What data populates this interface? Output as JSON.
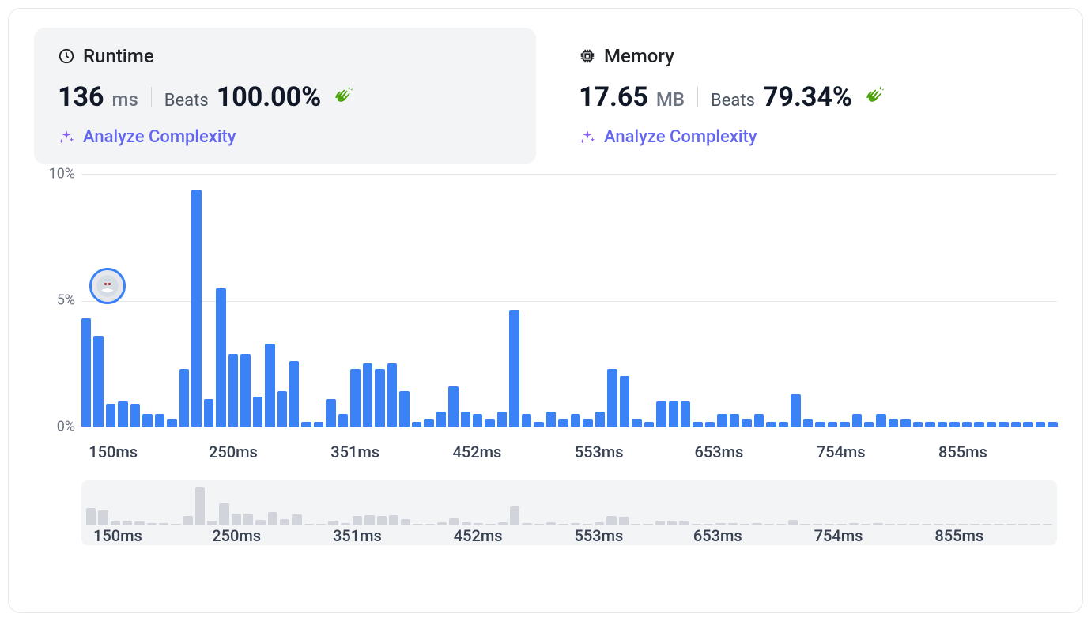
{
  "runtime": {
    "title": "Runtime",
    "value": "136",
    "unit": "ms",
    "beats_label": "Beats",
    "beats_value": "100.00%",
    "analyze_label": "Analyze Complexity"
  },
  "memory": {
    "title": "Memory",
    "value": "17.65",
    "unit": "MB",
    "beats_label": "Beats",
    "beats_value": "79.34%",
    "analyze_label": "Analyze Complexity"
  },
  "chart_data": {
    "type": "bar",
    "title": "",
    "xlabel": "",
    "ylabel": "",
    "ylim": [
      0,
      10
    ],
    "y_ticks": [
      "10%",
      "5%",
      "0%"
    ],
    "x_ticks": [
      "150ms",
      "250ms",
      "351ms",
      "452ms",
      "553ms",
      "653ms",
      "754ms",
      "855ms"
    ],
    "x_tick_positions_pct": [
      2,
      14.3,
      26.8,
      39.3,
      51.8,
      64.1,
      76.6,
      89.1
    ],
    "values": [
      4.3,
      3.6,
      0.9,
      1.0,
      0.9,
      0.5,
      0.5,
      0.3,
      2.3,
      9.4,
      1.1,
      5.5,
      2.9,
      2.9,
      1.2,
      3.3,
      1.4,
      2.6,
      0.2,
      0.2,
      1.1,
      0.5,
      2.3,
      2.5,
      2.3,
      2.5,
      1.4,
      0.2,
      0.3,
      0.6,
      1.6,
      0.6,
      0.5,
      0.3,
      0.6,
      4.6,
      0.5,
      0.2,
      0.6,
      0.3,
      0.5,
      0.3,
      0.6,
      2.3,
      2.0,
      0.3,
      0.2,
      1.0,
      1.0,
      1.0,
      0.2,
      0.2,
      0.5,
      0.5,
      0.3,
      0.5,
      0.2,
      0.2,
      1.3,
      0.3,
      0.2,
      0.2,
      0.2,
      0.5,
      0.2,
      0.5,
      0.3,
      0.3,
      0.2,
      0.2,
      0.2,
      0.2,
      0.2,
      0.2,
      0.2,
      0.2,
      0.2,
      0.2,
      0.2,
      0.2
    ]
  },
  "mini_chart_data": {
    "type": "bar",
    "x_ticks": [
      "150ms",
      "250ms",
      "351ms",
      "452ms",
      "553ms",
      "653ms",
      "754ms",
      "855ms"
    ],
    "x_tick_positions_pct": [
      2,
      14.3,
      26.8,
      39.3,
      51.8,
      64.1,
      76.6,
      89.1
    ],
    "values": [
      4.3,
      3.6,
      0.9,
      1.0,
      0.9,
      0.5,
      0.5,
      0.3,
      2.3,
      9.4,
      1.1,
      5.5,
      2.9,
      2.9,
      1.2,
      3.3,
      1.4,
      2.6,
      0.2,
      0.2,
      1.1,
      0.5,
      2.3,
      2.5,
      2.3,
      2.5,
      1.4,
      0.2,
      0.3,
      0.6,
      1.6,
      0.6,
      0.5,
      0.3,
      0.6,
      4.6,
      0.5,
      0.2,
      0.6,
      0.3,
      0.5,
      0.3,
      0.6,
      2.3,
      2.0,
      0.3,
      0.2,
      1.0,
      1.0,
      1.0,
      0.2,
      0.2,
      0.5,
      0.5,
      0.3,
      0.5,
      0.2,
      0.2,
      1.3,
      0.3,
      0.2,
      0.2,
      0.2,
      0.5,
      0.2,
      0.5,
      0.3,
      0.3,
      0.2,
      0.2,
      0.2,
      0.2,
      0.2,
      0.2,
      0.2,
      0.2,
      0.2,
      0.2,
      0.2,
      0.2
    ]
  }
}
